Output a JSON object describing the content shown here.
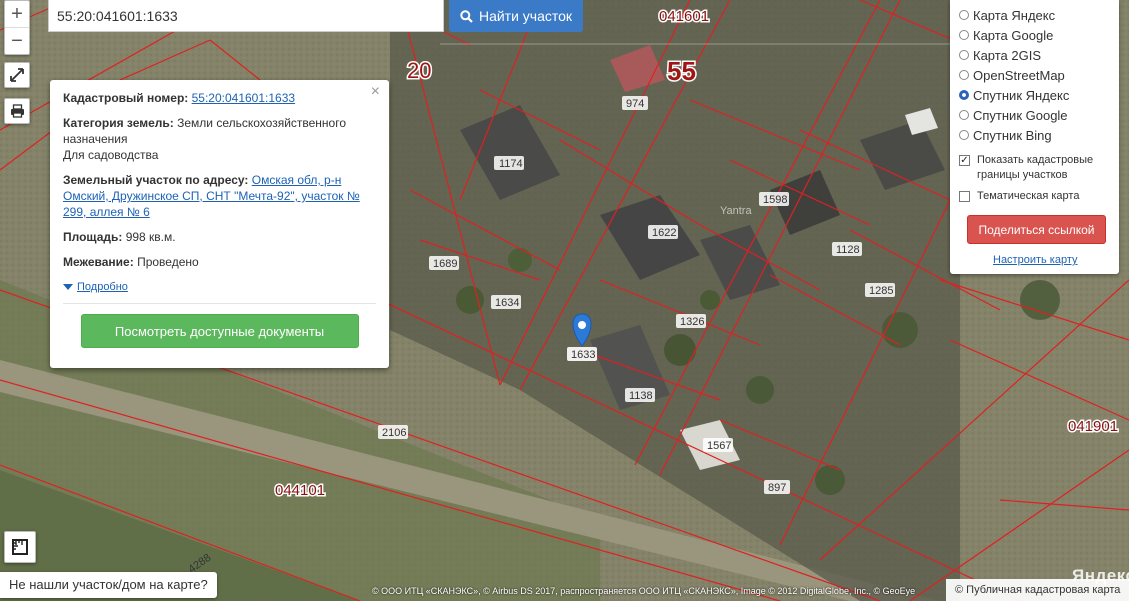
{
  "search": {
    "value": "55:20:041601:1633",
    "button_label": "Найти участок"
  },
  "zoom": {
    "in_label": "+",
    "out_label": "−"
  },
  "popup": {
    "close_label": "×",
    "cadastral_number_label": "Кадастровый номер:",
    "cadastral_number_value": "55:20:041601:1633",
    "category_label": "Категория земель:",
    "category_value": "Земли сельскохозяйственного назначения",
    "category_use": "Для садоводства",
    "address_label": "Земельный участок по адресу:",
    "address_value": "Омская обл, р-н Омский, Дружинское СП, СНТ \"Мечта-92\", участок № 299, аллея № 6",
    "area_label": "Площадь:",
    "area_value": "998 кв.м.",
    "survey_label": "Межевание:",
    "survey_value": "Проведено",
    "more_label": "Подробно",
    "docs_button": "Посмотреть доступные документы"
  },
  "layers": {
    "options": [
      {
        "label": "Карта Яндекс",
        "selected": false
      },
      {
        "label": "Карта Google",
        "selected": false
      },
      {
        "label": "Карта 2GIS",
        "selected": false
      },
      {
        "label": "OpenStreetMap",
        "selected": false
      },
      {
        "label": "Спутник Яндекс",
        "selected": true
      },
      {
        "label": "Спутник Google",
        "selected": false
      },
      {
        "label": "Спутник Bing",
        "selected": false
      }
    ],
    "show_boundaries_label": "Показать кадастровые границы участков",
    "show_boundaries_checked": true,
    "thematic_label": "Тематическая карта",
    "thematic_checked": false,
    "share_button": "Поделиться ссылкой",
    "settings_link": "Настроить карту"
  },
  "map": {
    "selected_parcel": "1633",
    "parcel_labels": [
      "1174",
      "974",
      "1598",
      "1622",
      "1689",
      "1634",
      "1326",
      "1128",
      "1285",
      "1138",
      "1567",
      "897",
      "2106",
      "4288"
    ],
    "block_labels": [
      "041601",
      "041901",
      "044101"
    ],
    "region_labels": [
      "20",
      "55"
    ],
    "ground_text": "Yantra"
  },
  "not_found_label": "Не нашли участок/дом на карте?",
  "attribution": "© ООО ИТЦ «СКАНЭКС», © Airbus DS 2017, распространяется ООО ИТЦ «СКАНЭКС», Image © 2012 DigitalGlobe, Inc., © GeoEye",
  "yandex_logo": "Яндекс",
  "pkk_credit": "© Публичная кадастровая карта",
  "colors": {
    "parcel_border": "#e02020",
    "search_button": "#3a7ac7",
    "docs_button": "#5cb85c",
    "share_button": "#d9534f",
    "link": "#1d62b5"
  }
}
